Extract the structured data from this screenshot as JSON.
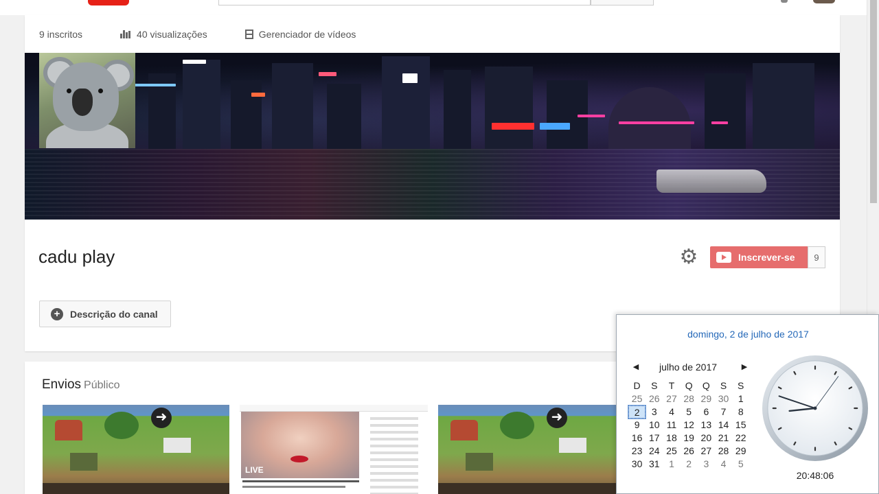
{
  "stats": {
    "subscribers": "9 inscritos",
    "views": "40 visualizações",
    "video_manager": "Gerenciador de vídeos"
  },
  "channel": {
    "name": "cadu play",
    "subscribe_label": "Inscrever-se",
    "subscriber_count": "9",
    "description_button": "Descrição do canal"
  },
  "uploads": {
    "title": "Envios",
    "visibility": "Público",
    "thumbnails": [
      {
        "id": "game-1",
        "icon": "arrow-right-icon"
      },
      {
        "id": "music-live",
        "overlay_text": "LIVE"
      },
      {
        "id": "game-2",
        "icon": "arrow-right-icon"
      }
    ]
  },
  "calendar": {
    "full_date": "domingo, 2 de julho de 2017",
    "month_label": "julho de 2017",
    "prev_glyph": "◀",
    "next_glyph": "▶",
    "weekdays": [
      "D",
      "S",
      "T",
      "Q",
      "Q",
      "S",
      "S"
    ],
    "weeks": [
      [
        "25",
        "26",
        "27",
        "28",
        "29",
        "30",
        "1"
      ],
      [
        "2",
        "3",
        "4",
        "5",
        "6",
        "7",
        "8"
      ],
      [
        "9",
        "10",
        "11",
        "12",
        "13",
        "14",
        "15"
      ],
      [
        "16",
        "17",
        "18",
        "19",
        "20",
        "21",
        "22"
      ],
      [
        "23",
        "24",
        "25",
        "26",
        "27",
        "28",
        "29"
      ],
      [
        "30",
        "31",
        "1",
        "2",
        "3",
        "4",
        "5"
      ]
    ],
    "today": "2",
    "clock_time": "20:48:06",
    "clock_hours": 20,
    "clock_minutes": 48,
    "clock_seconds": 6
  },
  "colors": {
    "accent_link": "#2468b8",
    "subscribe_bg": "#e66d6d"
  }
}
